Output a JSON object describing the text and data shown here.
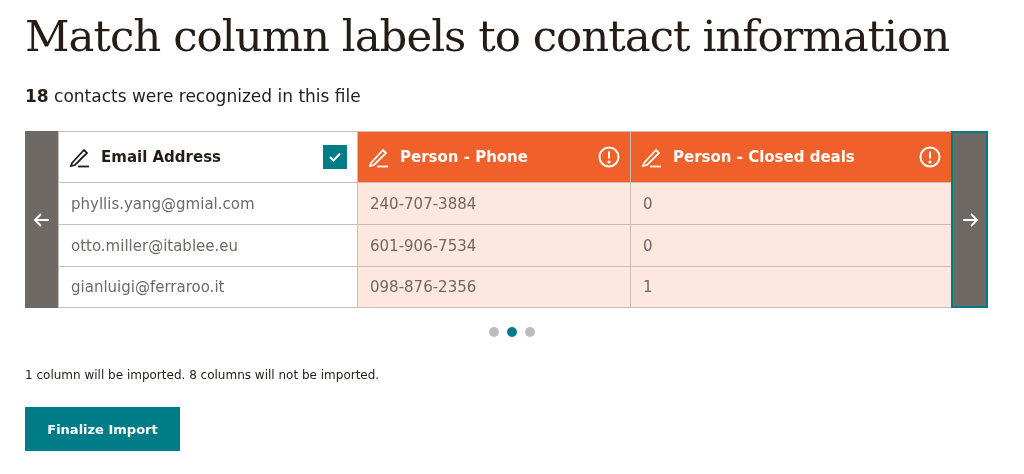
{
  "title": "Match column labels to contact information",
  "subtitle": "**18** contacts were recognized in this file",
  "table": {
    "columns": [
      {
        "label": "Email Address",
        "matched": true,
        "cells": [
          "phyllis.yang@gmial.com",
          "otto.miller@itablee.eu",
          "gianluigi@ferraroo.it"
        ]
      },
      {
        "label": "Person - Phone",
        "matched": false,
        "cells": [
          "240-707-3884",
          "601-906-7534",
          "098-876-2356"
        ]
      },
      {
        "label": "Person - Closed deals",
        "matched": false,
        "cells": [
          "0",
          "0",
          "1"
        ]
      }
    ]
  },
  "pages": [
    {
      "selected": false
    },
    {
      "selected": true
    },
    {
      "selected": false
    }
  ],
  "summary": "1 column will be imported. 8 columns will not be imported.",
  "button": "Finalize Import"
}
